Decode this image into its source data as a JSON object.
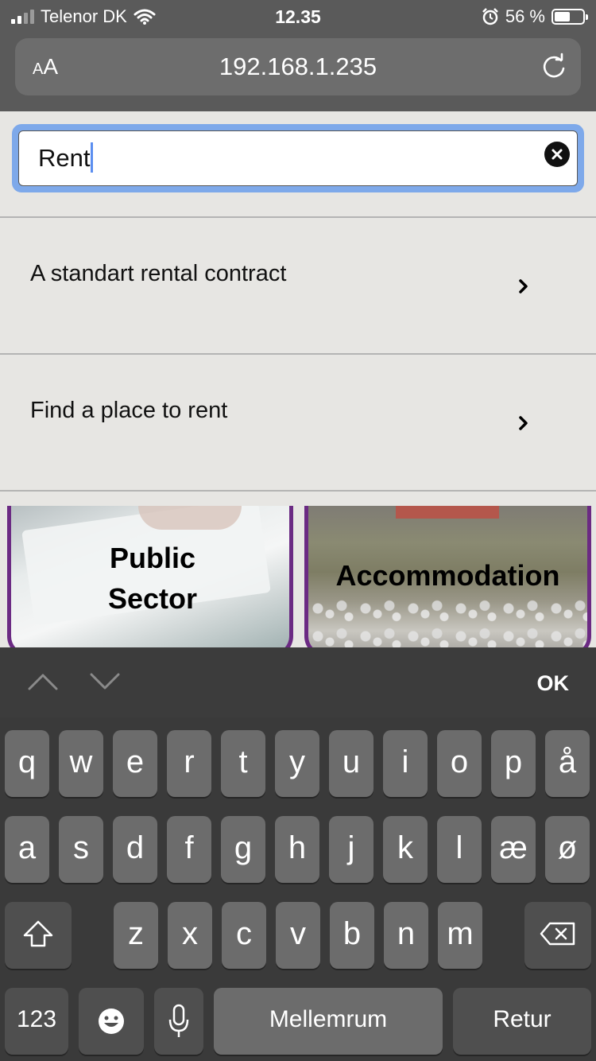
{
  "status_bar": {
    "carrier": "Telenor DK",
    "time": "12.35",
    "battery_percent": "56 %",
    "battery_level": 0.56
  },
  "browser": {
    "text_size_label_small": "A",
    "text_size_label_large": "A",
    "url": "192.168.1.235"
  },
  "search": {
    "value": "Rent"
  },
  "results": [
    {
      "label": "A standart rental contract"
    },
    {
      "label": "Find a place to rent"
    }
  ],
  "tiles": [
    {
      "title": "Public Sector"
    },
    {
      "title": "Accommodation"
    }
  ],
  "keyboard": {
    "done_label": "OK",
    "row1": [
      "q",
      "w",
      "e",
      "r",
      "t",
      "y",
      "u",
      "i",
      "o",
      "p",
      "å"
    ],
    "row2": [
      "a",
      "s",
      "d",
      "f",
      "g",
      "h",
      "j",
      "k",
      "l",
      "æ",
      "ø"
    ],
    "row3": [
      "z",
      "x",
      "c",
      "v",
      "b",
      "n",
      "m"
    ],
    "numbers_label": "123",
    "space_label": "Mellemrum",
    "return_label": "Retur"
  },
  "colors": {
    "tile_border": "#6b2a83",
    "search_focus": "#7ea9ea"
  }
}
